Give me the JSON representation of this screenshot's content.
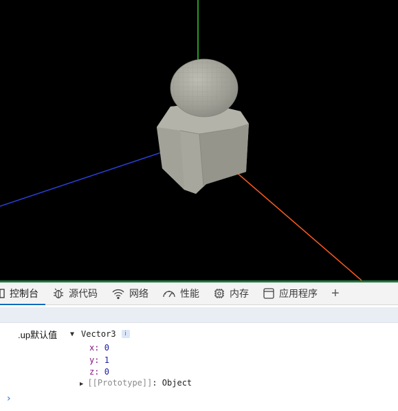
{
  "viewport": {
    "background": "#000000",
    "axis_colors": {
      "x": "#ff5a1f",
      "y": "#33cc33",
      "z": "#2a3fd6"
    },
    "mesh_color": "#a3a39a"
  },
  "devtools": {
    "tabs": [
      {
        "label": "控制台",
        "icon": "console-icon",
        "active": true
      },
      {
        "label": "源代码",
        "icon": "bug-icon",
        "active": false
      },
      {
        "label": "网络",
        "icon": "wifi-icon",
        "active": false
      },
      {
        "label": "性能",
        "icon": "gauge-icon",
        "active": false
      },
      {
        "label": "内存",
        "icon": "chip-icon",
        "active": false
      },
      {
        "label": "应用程序",
        "icon": "app-window-icon",
        "active": false
      }
    ],
    "add_tab": "+",
    "accent": "#0f6cbd"
  },
  "console": {
    "log_label": ".up默认值",
    "object_type": "Vector3",
    "info_badge": "i",
    "props": [
      {
        "key": "x",
        "value": "0"
      },
      {
        "key": "y",
        "value": "1"
      },
      {
        "key": "z",
        "value": "0"
      }
    ],
    "prototype_key": "[[Prototype]]",
    "prototype_value": "Object",
    "prompt": "›"
  }
}
